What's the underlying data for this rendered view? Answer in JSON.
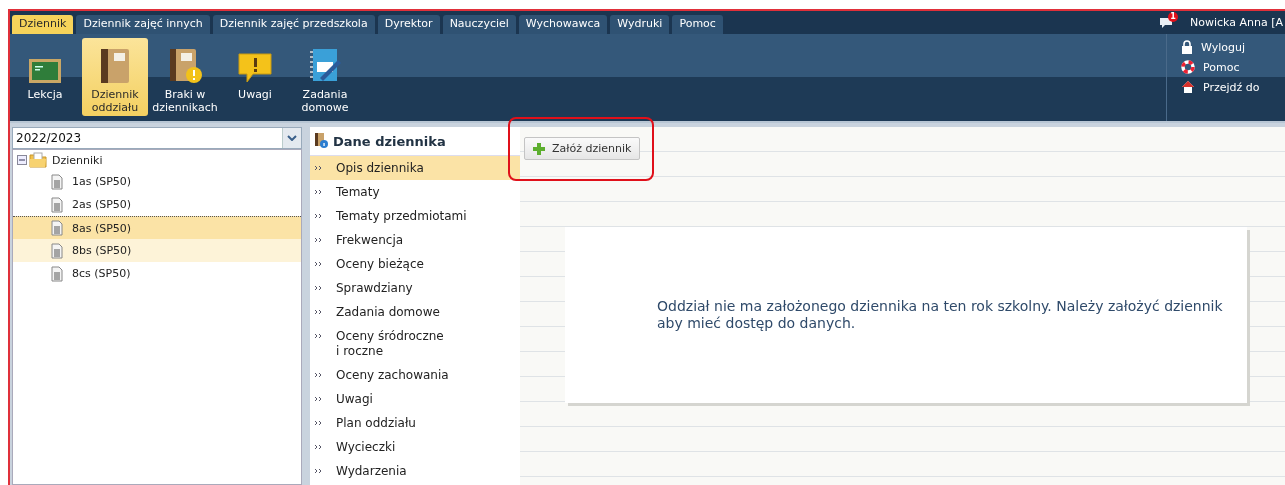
{
  "top_tabs": [
    {
      "label": "Dziennik",
      "selected": true
    },
    {
      "label": "Dziennik zajęć innych",
      "selected": false
    },
    {
      "label": "Dziennik zajęć przedszkola",
      "selected": false
    },
    {
      "label": "Dyrektor",
      "selected": false
    },
    {
      "label": "Nauczyciel",
      "selected": false
    },
    {
      "label": "Wychowawca",
      "selected": false
    },
    {
      "label": "Wydruki",
      "selected": false
    },
    {
      "label": "Pomoc",
      "selected": false
    }
  ],
  "notifications": {
    "badge": "1"
  },
  "user": {
    "name": "Nowicka Anna [A"
  },
  "ribbon": [
    {
      "kind": "board",
      "label": "Lekcja",
      "selected": false
    },
    {
      "kind": "book",
      "label": "Dziennik oddziału",
      "selected": true
    },
    {
      "kind": "book-warning",
      "label": "Braki w dziennikach",
      "selected": false
    },
    {
      "kind": "note",
      "label": "Uwagi",
      "selected": false
    },
    {
      "kind": "notebook",
      "label": "Zadania domowe",
      "selected": false
    }
  ],
  "side_links": [
    {
      "kind": "lock",
      "label": "Wyloguj"
    },
    {
      "kind": "lifebuoy",
      "label": "Pomoc"
    },
    {
      "kind": "home",
      "label": "Przejdź do"
    }
  ],
  "year_select": {
    "value": "2022/2023"
  },
  "tree": {
    "label": "Dzienniki",
    "expanded": true,
    "children": [
      {
        "label": "1as (SP50)",
        "selected": false,
        "highlighted": false
      },
      {
        "label": "2as (SP50)",
        "selected": false,
        "highlighted": false
      },
      {
        "label": "8as (SP50)",
        "selected": true,
        "highlighted": false
      },
      {
        "label": "8bs (SP50)",
        "selected": false,
        "highlighted": true
      },
      {
        "label": "8cs (SP50)",
        "selected": false,
        "highlighted": false
      }
    ]
  },
  "menu": {
    "title": "Dane dziennika",
    "items": [
      {
        "label": "Opis dziennika",
        "selected": true
      },
      {
        "label": "Tematy",
        "selected": false
      },
      {
        "label": "Tematy przedmiotami",
        "selected": false
      },
      {
        "label": "Frekwencja",
        "selected": false
      },
      {
        "label": "Oceny bieżące",
        "selected": false
      },
      {
        "label": "Sprawdziany",
        "selected": false
      },
      {
        "label": "Zadania domowe",
        "selected": false
      },
      {
        "label": "Oceny śródroczne\ni roczne",
        "selected": false
      },
      {
        "label": "Oceny zachowania",
        "selected": false
      },
      {
        "label": "Uwagi",
        "selected": false
      },
      {
        "label": "Plan oddziału",
        "selected": false
      },
      {
        "label": "Wycieczki",
        "selected": false
      },
      {
        "label": "Wydarzenia",
        "selected": false
      }
    ]
  },
  "toolbar": {
    "button": "Załóż dziennik",
    "highlighted": true
  },
  "message": "Oddział nie ma założonego dziennika na ten rok szkolny. Należy założyć dziennik aby mieć dostęp do danych."
}
